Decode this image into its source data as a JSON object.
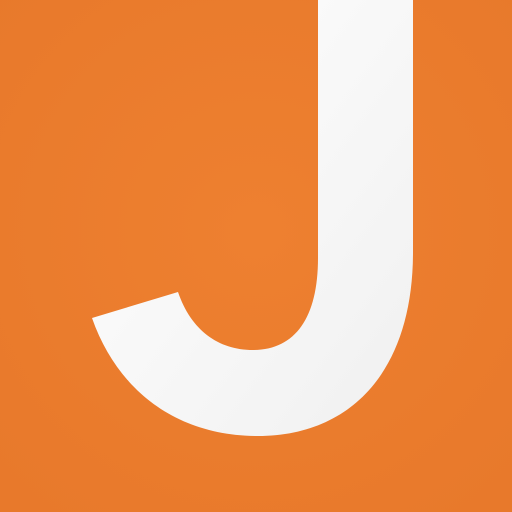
{
  "icon": {
    "letter": "J",
    "background_color": "#e8792b",
    "background_highlight": "#ee8030",
    "letter_color": "#ffffff",
    "letter_shade": "#f0f0f0"
  }
}
